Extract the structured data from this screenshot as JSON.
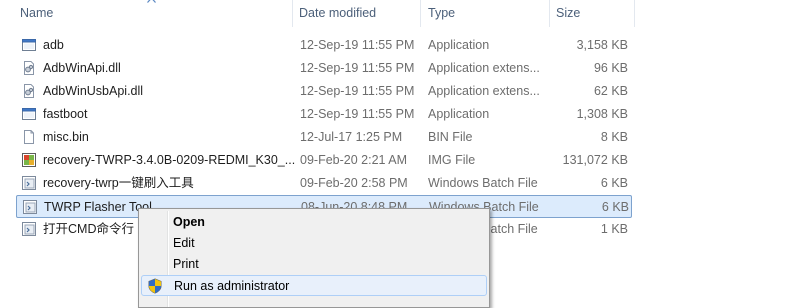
{
  "columns": {
    "name": "Name",
    "date": "Date modified",
    "type": "Type",
    "size": "Size"
  },
  "files": [
    {
      "name": "adb",
      "date": "12-Sep-19 11:55 PM",
      "type": "Application",
      "size": "3,158 KB",
      "icon": "application-icon"
    },
    {
      "name": "AdbWinApi.dll",
      "date": "12-Sep-19 11:55 PM",
      "type": "Application extens...",
      "size": "96 KB",
      "icon": "dll-file-icon"
    },
    {
      "name": "AdbWinUsbApi.dll",
      "date": "12-Sep-19 11:55 PM",
      "type": "Application extens...",
      "size": "62 KB",
      "icon": "dll-file-icon"
    },
    {
      "name": "fastboot",
      "date": "12-Sep-19 11:55 PM",
      "type": "Application",
      "size": "1,308 KB",
      "icon": "application-icon"
    },
    {
      "name": "misc.bin",
      "date": "12-Jul-17 1:25 PM",
      "type": "BIN File",
      "size": "8 KB",
      "icon": "blank-file-icon"
    },
    {
      "name": "recovery-TWRP-3.4.0B-0209-REDMI_K30_...",
      "date": "09-Feb-20 2:21 AM",
      "type": "IMG File",
      "size": "131,072 KB",
      "icon": "img-file-icon"
    },
    {
      "name": "recovery-twrp一键刷入工具",
      "date": "09-Feb-20 2:58 PM",
      "type": "Windows Batch File",
      "size": "6 KB",
      "icon": "batch-file-icon"
    },
    {
      "name": "TWRP Flasher Tool",
      "date": "08-Jun-20 8:48 PM",
      "type": "Windows Batch File",
      "size": "6 KB",
      "icon": "batch-file-icon"
    },
    {
      "name": "打开CMD命令行",
      "date": "",
      "type": "Windows Batch File",
      "size": "1 KB",
      "icon": "batch-file-icon"
    }
  ],
  "selected_row": 7,
  "context_menu": {
    "items": [
      {
        "label": "Open",
        "bold": true,
        "icon": ""
      },
      {
        "label": "Edit",
        "bold": false,
        "icon": ""
      },
      {
        "label": "Print",
        "bold": false,
        "icon": ""
      },
      {
        "label": "Run as administrator",
        "bold": false,
        "icon": "uac-shield-icon",
        "hover": true
      }
    ]
  },
  "colors": {
    "header_text": "#4c607a",
    "selection_bg": "#dcebfc",
    "selection_border": "#7da2ce",
    "menu_bg": "#f0f0f0",
    "menu_hover_bg": "#e8f0fb"
  }
}
